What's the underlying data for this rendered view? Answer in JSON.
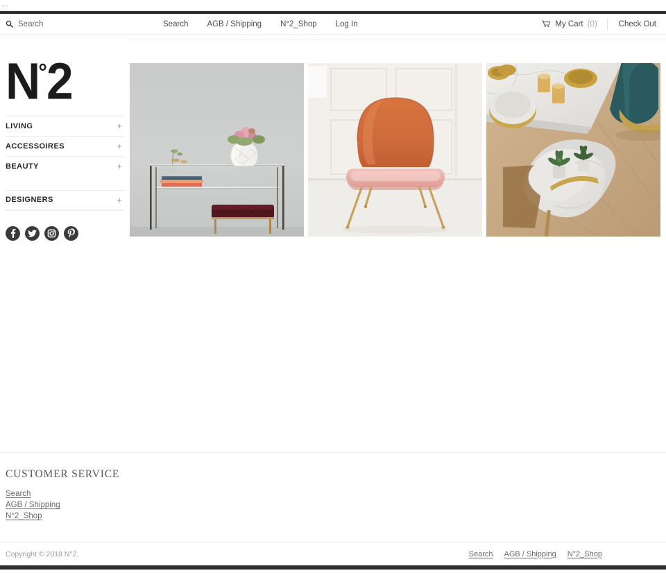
{
  "browser": {
    "dots": "..."
  },
  "header": {
    "search": {
      "placeholder": "Search",
      "value": "",
      "icon": "search-icon"
    },
    "nav": [
      {
        "label": "Search"
      },
      {
        "label": "AGB / Shipping"
      },
      {
        "label": "N°2_Shop"
      },
      {
        "label": "Log In"
      }
    ],
    "cart": {
      "label": "My Cart",
      "count": "(0)",
      "icon": "shopping-cart-icon"
    },
    "checkout": {
      "label": "Check Out"
    }
  },
  "sidebar": {
    "logo": {
      "prefix": "N",
      "degree": "°",
      "suffix": "2",
      "full": "N°2"
    },
    "categories": [
      {
        "label": "LIVING",
        "expander": "+"
      },
      {
        "label": "ACCESSOIRES",
        "expander": "+"
      },
      {
        "label": "BEAUTY",
        "expander": "+"
      }
    ],
    "secondary": [
      {
        "label": "DESIGNERS",
        "expander": "+"
      }
    ],
    "social": [
      {
        "name": "facebook-icon",
        "label": "Facebook"
      },
      {
        "name": "twitter-icon",
        "label": "Twitter"
      },
      {
        "name": "instagram-icon",
        "label": "Instagram"
      },
      {
        "name": "pinterest-icon",
        "label": "Pinterest"
      }
    ]
  },
  "main": {
    "tiles": [
      {
        "alt": "Glass and brass console table with patterned vase, pink flowers, books and burgundy velvet stool against a grey wall"
      },
      {
        "alt": "Orange leather lounge chair with pink seat cushion and brass legs against a white panelled wall"
      },
      {
        "alt": "Marble coffee tables from above with succulents, brass trays, glass tumblers and a teal velvet ottoman on a wood floor"
      }
    ]
  },
  "footer": {
    "heading": "CUSTOMER SERVICE",
    "links": [
      {
        "label": "Search"
      },
      {
        "label": "AGB / Shipping"
      },
      {
        "label": "N°2_Shop"
      }
    ],
    "copyright": "Copyright © 2018 N°2.",
    "bottom_links": [
      {
        "label": "Search"
      },
      {
        "label": "AGB / Shipping"
      },
      {
        "label": "N°2_Shop"
      }
    ]
  },
  "colors": {
    "ink": "#1c1c1c",
    "rule": "#ececec",
    "muted": "#9d9d9d",
    "bar": "#2f2f2f",
    "social_bg": "#3a3a3a"
  }
}
